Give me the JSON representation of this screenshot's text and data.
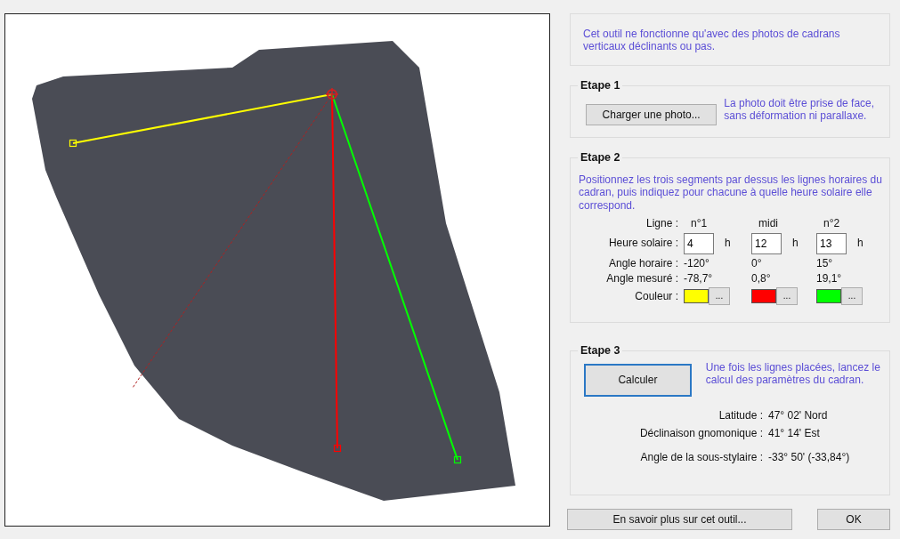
{
  "intro": "Cet outil ne fonctionne qu'avec des photos de cadrans verticaux déclinants ou pas.",
  "step1": {
    "title": "Etape 1",
    "button": "Charger une photo...",
    "note": "La photo doit être prise de face, sans déformation ni parallaxe."
  },
  "step2": {
    "title": "Etape 2",
    "note": "Positionnez les trois segments par dessus les lignes horaires du cadran, puis indiquez pour chacune à quelle heure solaire elle correspond.",
    "row_labels": [
      "Ligne :",
      "Heure solaire :",
      "Angle horaire :",
      "Angle mesuré :",
      "Couleur :"
    ],
    "lines": [
      {
        "name": "n°1",
        "hour": "4",
        "unit": "h",
        "hour_angle": "-120°",
        "measured": "-78,7°",
        "color": "#ffff00",
        "color_button": "..."
      },
      {
        "name": "midi",
        "hour": "12",
        "unit": "h",
        "hour_angle": "0°",
        "measured": "0,8°",
        "color": "#ff0000",
        "color_button": "..."
      },
      {
        "name": "n°2",
        "hour": "13",
        "unit": "h",
        "hour_angle": "15°",
        "measured": "19,1°",
        "color": "#00ff00",
        "color_button": "..."
      }
    ]
  },
  "step3": {
    "title": "Etape 3",
    "button": "Calculer",
    "focused": true,
    "note": "Une fois les lignes placées, lancez le calcul des paramètres du cadran.",
    "results": [
      {
        "label": "Latitude :",
        "value": "47° 02' Nord"
      },
      {
        "label": "Déclinaison gnomonique :",
        "value": "41° 14' Est"
      },
      {
        "label": "Angle de la sous-stylaire :",
        "value": "-33° 50' (-33,84°)"
      }
    ]
  },
  "footer_buttons": [
    "En savoir plus sur cet outil...",
    "OK"
  ]
}
